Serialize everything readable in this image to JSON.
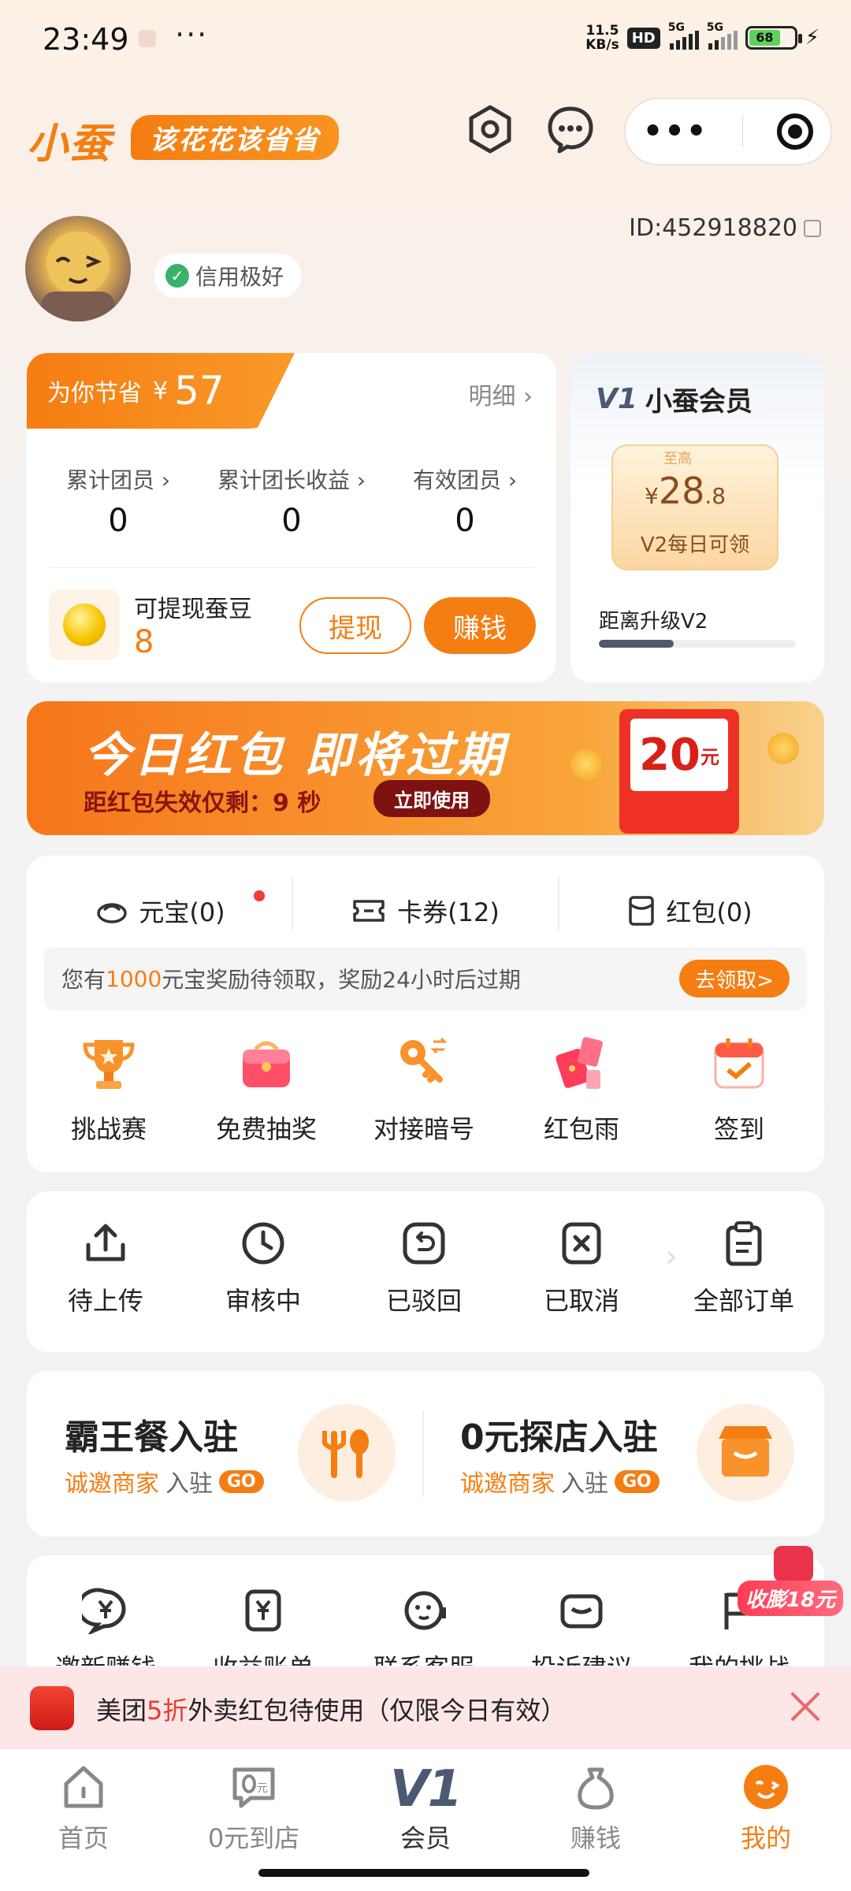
{
  "status_bar": {
    "time": "23:49",
    "dots": "···",
    "net_speed_top": "11.5",
    "net_speed_bottom": "KB/s",
    "hd": "HD",
    "sig1": "5G",
    "sig2": "5G",
    "battery": "68"
  },
  "header": {
    "brand": "小蚕",
    "slogan": "该花花该省省",
    "capsule_dots": "•••"
  },
  "profile": {
    "credit": "信用极好",
    "id_text": "ID:452918820"
  },
  "savings": {
    "tab_label": "为你节省",
    "currency": "¥",
    "amount": "57",
    "detail": "明细 ›",
    "stats": [
      {
        "label": "累计团员 ›",
        "value": "0"
      },
      {
        "label": "累计团长收益 ›",
        "value": "0"
      },
      {
        "label": "有效团员 ›",
        "value": "0"
      }
    ],
    "bean_label": "可提现蚕豆",
    "bean_value": "8",
    "withdraw": "提现",
    "earn": "赚钱"
  },
  "member": {
    "badge": "V1",
    "title": "小蚕会员",
    "coupon_top": "至高",
    "coupon_currency": "¥",
    "coupon_int": "28",
    "coupon_dec": ".8",
    "coupon_note": "V2每日可领",
    "upgrade_label": "距离升级V2",
    "upgrade_progress": 0.38
  },
  "red_packet": {
    "title": "今日红包  即将过期",
    "subtitle": "距红包失效仅剩：9 秒",
    "use_btn": "立即使用",
    "envelope_value": "20",
    "envelope_unit": "元"
  },
  "wallet": {
    "tabs": [
      {
        "label": "元宝(0)"
      },
      {
        "label": "卡券(12)"
      },
      {
        "label": "红包(0)"
      }
    ],
    "reward_prefix": "您有",
    "reward_amount": "1000",
    "reward_suffix": "元宝奖励待领取，奖励24小时后过期",
    "claim": "去领取>",
    "features": [
      {
        "label": "挑战赛",
        "icon": "trophy-icon"
      },
      {
        "label": "免费抽奖",
        "icon": "gift-box-icon"
      },
      {
        "label": "对接暗号",
        "icon": "key-icon"
      },
      {
        "label": "红包雨",
        "icon": "red-envelope-icon"
      },
      {
        "label": "签到",
        "icon": "calendar-check-icon"
      }
    ]
  },
  "orders": [
    {
      "label": "待上传",
      "icon": "upload-icon"
    },
    {
      "label": "审核中",
      "icon": "clock-icon"
    },
    {
      "label": "已驳回",
      "icon": "return-icon"
    },
    {
      "label": "已取消",
      "icon": "cancel-icon"
    },
    {
      "label": "全部订单",
      "icon": "clipboard-icon"
    }
  ],
  "merchants": [
    {
      "title": "霸王餐入驻",
      "sub_hl": "诚邀商家",
      "sub": "入驻",
      "go": "GO"
    },
    {
      "title": "0元探店入驻",
      "sub_hl": "诚邀商家",
      "sub": "入驻",
      "go": "GO"
    }
  ],
  "services": [
    {
      "label": "邀新赚钱",
      "icon": "yen-chat-icon"
    },
    {
      "label": "收益账单",
      "icon": "yen-wallet-icon"
    },
    {
      "label": "联系客服",
      "icon": "support-icon"
    },
    {
      "label": "投诉建议",
      "icon": "mail-icon"
    },
    {
      "label": "我的挑战",
      "icon": "flag-icon"
    }
  ],
  "float_badge": "收膨18元",
  "notice": {
    "prefix": "美团",
    "hl": "5折",
    "suffix": "外卖红包待使用（仅限今日有效）"
  },
  "tabbar": [
    {
      "label": "首页",
      "icon": "home-icon"
    },
    {
      "label": "0元到店",
      "icon": "zero-store-icon"
    },
    {
      "label": "会员",
      "icon": "v1-icon",
      "badge": "V1"
    },
    {
      "label": "赚钱",
      "icon": "money-bag-icon"
    },
    {
      "label": "我的",
      "icon": "profile-face-icon"
    }
  ],
  "colors": {
    "accent": "#f57e13",
    "danger": "#e93a2e"
  }
}
